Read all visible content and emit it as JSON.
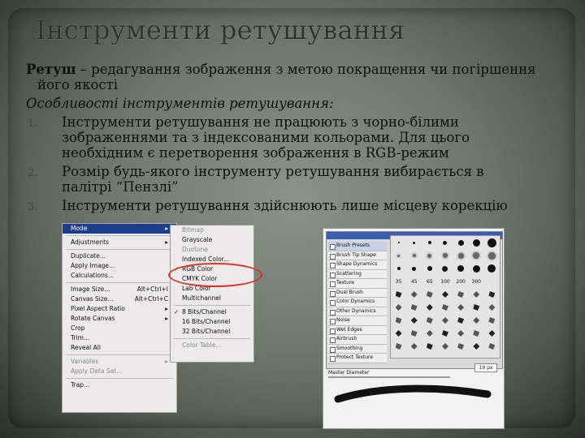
{
  "slide": {
    "title": "Інструменти ретушування",
    "lead_bold": "Ретуш",
    "lead_rest": " – редагування зображення з метою покращення чи погіршення",
    "lead_cont": "його якості",
    "features_heading": "Особливості інструментів ретушування:",
    "items": [
      {
        "num": "1.",
        "line1": "Інструменти ретушування не працюють з чорно-білими",
        "line2": "зображеннями та з індексованими кольорами. Для цього",
        "line3": "необхідним є перетворення  зображення в RGB-режим"
      },
      {
        "num": "2.",
        "line1": "Розмір будь-якого інструменту ретушування вибирається в",
        "line2": "палітрі “Пензлі”"
      },
      {
        "num": "3.",
        "line1": "Інструменти ретушування здійснюють лише місцеву корекцію"
      }
    ]
  },
  "image_menu": {
    "items": [
      "Mode",
      "Adjustments",
      "Duplicate...",
      "Apply Image...",
      "Calculations...",
      "Image Size...",
      "Canvas Size...",
      "Pixel Aspect Ratio",
      "Rotate Canvas",
      "Crop",
      "Trim...",
      "Reveal All",
      "Variables",
      "Apply Data Set...",
      "Trap..."
    ],
    "shortcuts": {
      "image_size": "Alt+Ctrl+I",
      "canvas_size": "Alt+Ctrl+C"
    }
  },
  "mode_submenu": {
    "items": [
      "Bitmap",
      "Grayscale",
      "Duotone",
      "Indexed Color...",
      "RGB Color",
      "CMYK Color",
      "Lab Color",
      "Multichannel",
      "8 Bits/Channel",
      "16 Bits/Channel",
      "32 Bits/Channel",
      "Color Table..."
    ]
  },
  "brushes_panel": {
    "title": "Brush Presets",
    "options": [
      "Brush Tip Shape",
      "Shape Dynamics",
      "Scattering",
      "Texture",
      "Dual Brush",
      "Color Dynamics",
      "Other Dynamics",
      "Noise",
      "Wet Edges",
      "Airbrush",
      "Smoothing",
      "Protect Texture"
    ],
    "size_labels": [
      "35",
      "45",
      "65",
      "100",
      "200",
      "300"
    ],
    "diameter_label": "Master Diameter",
    "diameter_value": "19 px"
  }
}
